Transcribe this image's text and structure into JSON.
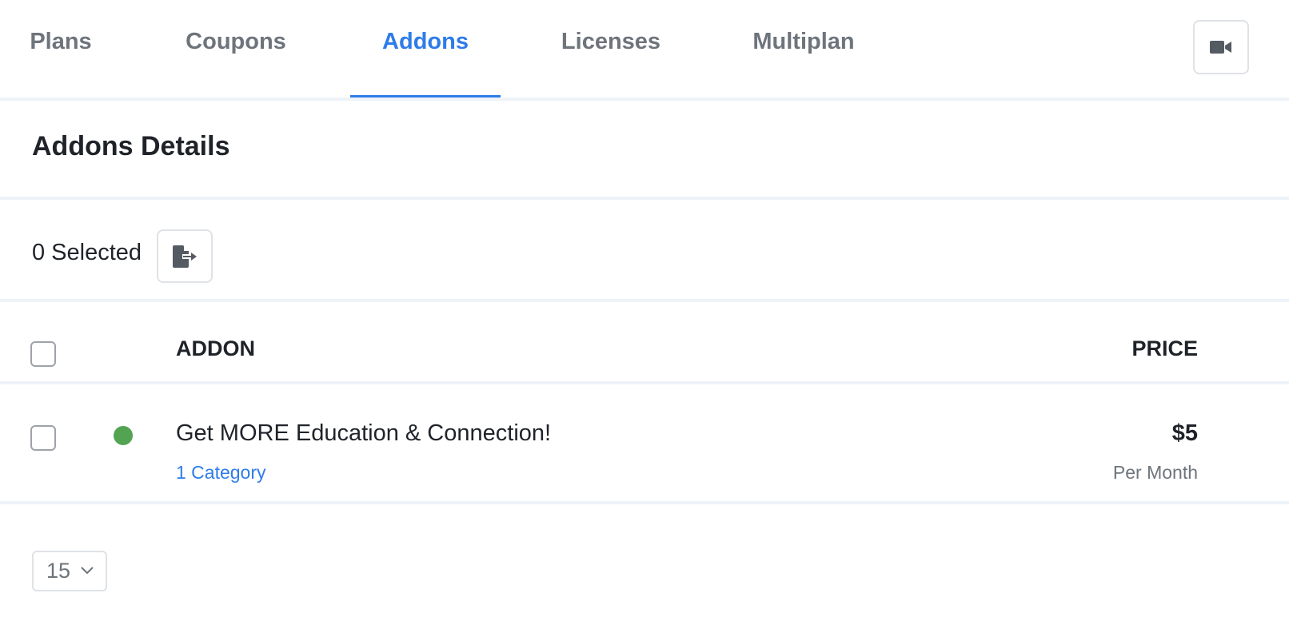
{
  "tabs": [
    {
      "label": "Plans",
      "active": false
    },
    {
      "label": "Coupons",
      "active": false
    },
    {
      "label": "Addons",
      "active": true
    },
    {
      "label": "Licenses",
      "active": false
    },
    {
      "label": "Multiplan",
      "active": false
    }
  ],
  "header": {
    "video_icon": "video-camera-icon"
  },
  "section": {
    "title": "Addons Details"
  },
  "selection": {
    "count_label": "0 Selected",
    "export_icon": "file-export-icon"
  },
  "table": {
    "columns": {
      "addon": "ADDON",
      "price": "PRICE"
    },
    "rows": [
      {
        "status": "active",
        "status_color": "#52a452",
        "name": "Get MORE Education & Connection!",
        "category": "1 Category",
        "price": "$5",
        "period": "Per Month"
      }
    ]
  },
  "pagination": {
    "per_page": "15",
    "icon": "chevron-down-icon"
  },
  "colors": {
    "accent": "#2e7ce9",
    "muted": "#6e747c",
    "text": "#1f2329",
    "divider": "#eef3f8"
  }
}
